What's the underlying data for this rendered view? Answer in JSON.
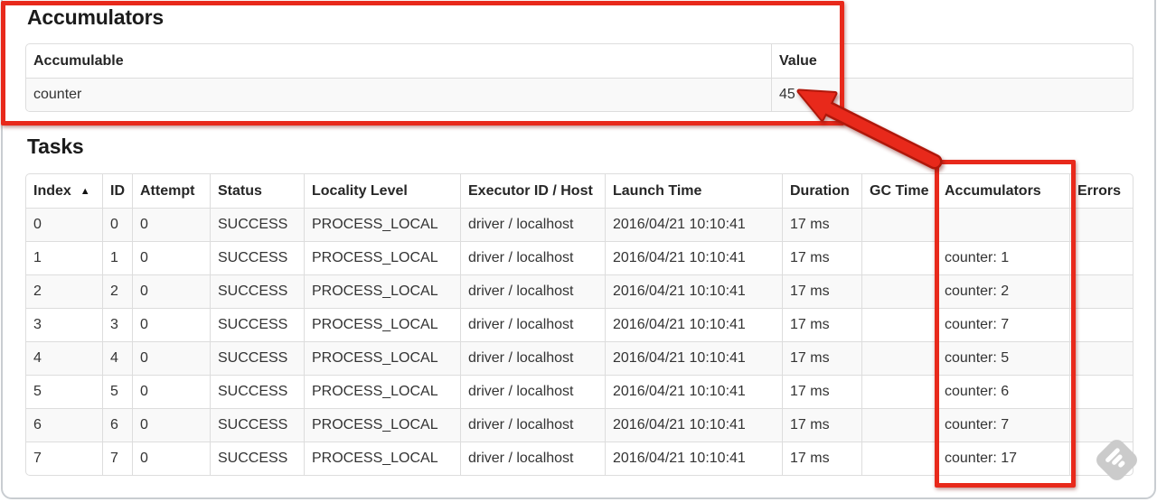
{
  "colors": {
    "annotation_red": "#e8291b",
    "annotation_red_dark": "#b0170a",
    "table_border": "#dddddd",
    "row_stripe": "#f9f9f9",
    "text": "#333333",
    "watermark_gray": "#cbcbcb"
  },
  "accumulators_section": {
    "title": "Accumulators",
    "table": {
      "headers": [
        "Accumulable",
        "Value"
      ],
      "rows": [
        [
          "counter",
          "45"
        ]
      ]
    }
  },
  "tasks_section": {
    "title": "Tasks",
    "table": {
      "headers": [
        "Index",
        "ID",
        "Attempt",
        "Status",
        "Locality Level",
        "Executor ID / Host",
        "Launch Time",
        "Duration",
        "GC Time",
        "Accumulators",
        "Errors"
      ],
      "sort": {
        "column": "Index",
        "indicator": "▲"
      },
      "rows": [
        [
          "0",
          "0",
          "0",
          "SUCCESS",
          "PROCESS_LOCAL",
          "driver / localhost",
          "2016/04/21 10:10:41",
          "17 ms",
          "",
          "",
          ""
        ],
        [
          "1",
          "1",
          "0",
          "SUCCESS",
          "PROCESS_LOCAL",
          "driver / localhost",
          "2016/04/21 10:10:41",
          "17 ms",
          "",
          "counter: 1",
          ""
        ],
        [
          "2",
          "2",
          "0",
          "SUCCESS",
          "PROCESS_LOCAL",
          "driver / localhost",
          "2016/04/21 10:10:41",
          "17 ms",
          "",
          "counter: 2",
          ""
        ],
        [
          "3",
          "3",
          "0",
          "SUCCESS",
          "PROCESS_LOCAL",
          "driver / localhost",
          "2016/04/21 10:10:41",
          "17 ms",
          "",
          "counter: 7",
          ""
        ],
        [
          "4",
          "4",
          "0",
          "SUCCESS",
          "PROCESS_LOCAL",
          "driver / localhost",
          "2016/04/21 10:10:41",
          "17 ms",
          "",
          "counter: 5",
          ""
        ],
        [
          "5",
          "5",
          "0",
          "SUCCESS",
          "PROCESS_LOCAL",
          "driver / localhost",
          "2016/04/21 10:10:41",
          "17 ms",
          "",
          "counter: 6",
          ""
        ],
        [
          "6",
          "6",
          "0",
          "SUCCESS",
          "PROCESS_LOCAL",
          "driver / localhost",
          "2016/04/21 10:10:41",
          "17 ms",
          "",
          "counter: 7",
          ""
        ],
        [
          "7",
          "7",
          "0",
          "SUCCESS",
          "PROCESS_LOCAL",
          "driver / localhost",
          "2016/04/21 10:10:41",
          "17 ms",
          "",
          "counter: 17",
          ""
        ]
      ]
    }
  },
  "annotations": {
    "highlighted_section": "Accumulators",
    "highlighted_column": "Accumulators",
    "value_pointed_at": "45"
  },
  "icons": {
    "sort_ascending": "▲",
    "watermark": "feedly-logo"
  }
}
